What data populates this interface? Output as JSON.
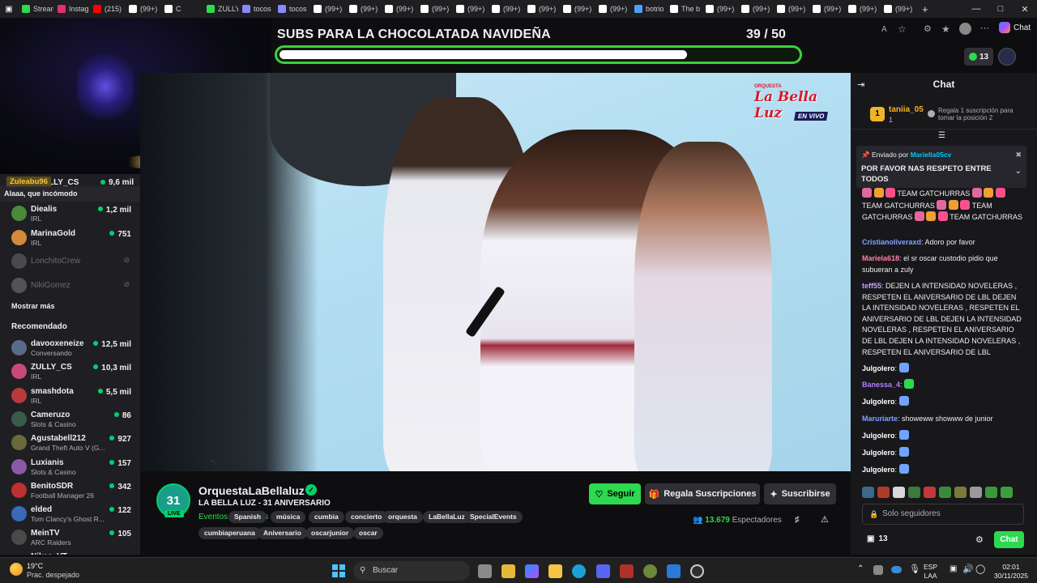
{
  "browser": {
    "tabs": [
      {
        "label": "",
        "color": "#ffffff"
      },
      {
        "label": "Stream",
        "color": "#2cd94f"
      },
      {
        "label": "Instag",
        "color": "#e1306c"
      },
      {
        "label": "(215)",
        "color": "#ff0000"
      },
      {
        "label": "(99+)",
        "color": "#ffffff"
      },
      {
        "label": "C",
        "color": "#ffffff"
      },
      {
        "label": "ZULLY",
        "color": "#2cd94f"
      },
      {
        "label": "tocos",
        "color": "#8888ff"
      },
      {
        "label": "tocos",
        "color": "#8888ff"
      },
      {
        "label": "(99+)",
        "color": "#ffffff"
      },
      {
        "label": "(99+)",
        "color": "#ffffff"
      },
      {
        "label": "(99+)",
        "color": "#ffffff"
      },
      {
        "label": "(99+)",
        "color": "#ffffff"
      },
      {
        "label": "(99+)",
        "color": "#ffffff"
      },
      {
        "label": "(99+)",
        "color": "#ffffff"
      },
      {
        "label": "(99+)",
        "color": "#ffffff"
      },
      {
        "label": "(99+)",
        "color": "#ffffff"
      },
      {
        "label": "(99+)",
        "color": "#ffffff"
      },
      {
        "label": "botrio",
        "color": "#4f9fff"
      },
      {
        "label": "The b",
        "color": "#ffffff"
      },
      {
        "label": "(99+)",
        "color": "#ffffff"
      },
      {
        "label": "(99+)",
        "color": "#ffffff"
      },
      {
        "label": "(99+)",
        "color": "#ffffff"
      },
      {
        "label": "(99+)",
        "color": "#ffffff"
      },
      {
        "label": "(99+)",
        "color": "#ffffff"
      },
      {
        "label": "(99+)",
        "color": "#ffffff"
      }
    ],
    "new_tab": "+"
  },
  "overlay": {
    "goal_title": "SUBS PARA LA CHOCOLATADA NAVIDEÑA",
    "goal_count": "39   / 50",
    "goal_progress": 0.78,
    "alert_user": "Zuleabu96",
    "alert_msg": "Alaaa, que incómodo"
  },
  "sidebar": {
    "followed": [
      {
        "name": "ZULLY_CS",
        "category": "",
        "viewers": "9,6 mil",
        "avatar": "#c94a7a",
        "online": true
      },
      {
        "name": "Diealis",
        "category": "IRL",
        "viewers": "1,2 mil",
        "avatar": "#4a8a3a",
        "online": true
      },
      {
        "name": "MarinaGold",
        "category": "IRL",
        "viewers": "751",
        "avatar": "#d48a3a",
        "online": true
      },
      {
        "name": "LonchitoCrew",
        "category": "",
        "viewers": "",
        "avatar": "#777777",
        "online": false
      },
      {
        "name": "NikiGomez",
        "category": "",
        "viewers": "",
        "avatar": "#888888",
        "online": false
      }
    ],
    "show_more": "Mostrar más",
    "recommended_title": "Recomendado",
    "recommended": [
      {
        "name": "davooxeneize",
        "category": "Conversando",
        "viewers": "12,5 mil",
        "avatar": "#5a6a8a"
      },
      {
        "name": "ZULLY_CS",
        "category": "IRL",
        "viewers": "10,3 mil",
        "avatar": "#c94a7a"
      },
      {
        "name": "smashdota",
        "category": "IRL",
        "viewers": "5,5 mil",
        "avatar": "#b83a3a"
      },
      {
        "name": "Cameruzo",
        "category": "Slots & Casino",
        "viewers": "86",
        "avatar": "#3a5a4a"
      },
      {
        "name": "Agustabell212",
        "category": "Grand Theft Auto V (G...",
        "viewers": "927",
        "avatar": "#6a6a3a"
      },
      {
        "name": "Luxianis",
        "category": "Slots & Casino",
        "viewers": "157",
        "avatar": "#8a5aa8"
      },
      {
        "name": "BenitoSDR",
        "category": "Football Manager 26",
        "viewers": "342",
        "avatar": "#c03030"
      },
      {
        "name": "elded",
        "category": "Tom Clancy's Ghost R...",
        "viewers": "122",
        "avatar": "#3a6ab8"
      },
      {
        "name": "MeinTV",
        "category": "ARC Raiders",
        "viewers": "105",
        "avatar": "#4a4a4a"
      }
    ],
    "partial_row": "Nikes_VT"
  },
  "video": {
    "logo_text": "La Bella Luz",
    "logo_sub": "EN VIVO",
    "logo_top": "ORQUESTA"
  },
  "channel": {
    "name": "OrquestaLaBellaluz",
    "avatar_text": "31",
    "live": "LIVE",
    "title": "LA BELLA LUZ -  31 ANIVERSARIO",
    "category": "Eventos especiales",
    "tags": [
      "Spanish",
      "música",
      "cumbia",
      "concierto",
      "orquesta",
      "LaBellaLuz",
      "SpecialEvents",
      "cumbiaperuana",
      "Aniversario",
      "oscarjunior",
      "oscar"
    ],
    "follow": "Seguir",
    "gift": "Regala Suscripciones",
    "subscribe": "Suscribirse",
    "viewer_count": "13.679",
    "viewer_label": "Espectadores"
  },
  "top_right": {
    "points": "13"
  },
  "chat": {
    "title": "Chat",
    "leader_name": "taniia_05",
    "leader_rank": "1",
    "leader_count": "1",
    "leader_hint": "Regala 1 suscripción para tomar la posición 2",
    "pinned_by_label": "Enviado por",
    "pinned_by_user": "Mariella05cv",
    "pinned_msg": "POR FAVOR NAS RESPETO ENTRE TODOS",
    "messages": [
      {
        "user": "",
        "color": "#efeff1",
        "text": "TEAM GATCHURRAS TEAM GATCHURRAS TEAM GATCHURRAS TEAM GATCHURRAS",
        "prefix": "emotes"
      },
      {
        "user": "Cristianoliveraxd",
        "color": "#7fa3ff",
        "text": "Adoro por favor"
      },
      {
        "user": "Mariela618",
        "color": "#ff7fa8",
        "text": "el sr oscar custodio pidio que subueran a zuly"
      },
      {
        "user": "teff55",
        "color": "#c9a0ff",
        "text": "DEJEN LA INTENSIDAD NOVELERAS , RESPETEN EL ANIVERSARIO DE LBL DEJEN LA INTENSIDAD NOVELERAS , RESPETEN EL ANIVERSARIO DE LBL DEJEN LA INTENSIDAD NOVELERAS , RESPETEN EL ANIVERSARIO DE LBL DEJEN LA INTENSIDAD NOVELERAS , RESPETEN EL ANIVERSARIO DE LBL"
      },
      {
        "user": "Julgolero",
        "color": "#ffffff",
        "text": "",
        "emote": "#6fa3ff"
      },
      {
        "user": "Banessa_4",
        "color": "#b07fff",
        "text": "",
        "emote": "#2cd94f"
      },
      {
        "user": "Julgolero",
        "color": "#ffffff",
        "text": "",
        "emote": "#6fa3ff"
      },
      {
        "user": "Maruriarte",
        "color": "#7fa3ff",
        "text": "showeww showww de junior"
      },
      {
        "user": "Julgolero",
        "color": "#ffffff",
        "text": "",
        "emote": "#6fa3ff"
      },
      {
        "user": "Julgolero",
        "color": "#ffffff",
        "text": "",
        "emote": "#6fa3ff"
      },
      {
        "user": "Julgolero",
        "color": "#ffffff",
        "text": "",
        "emote": "#6fa3ff"
      }
    ],
    "input_placeholder": "Solo seguidores",
    "points": "13",
    "send": "Chat"
  },
  "taskbar": {
    "weather_temp": "19°C",
    "weather_desc": "Prac. despejado",
    "search": "Buscar",
    "lang_top": "ESP",
    "lang_bottom": "LAA",
    "time": "02:01",
    "date": "30/11/2025"
  },
  "colors": {
    "accent": "#2cd94f",
    "goal_border": "#3ecf3e",
    "live_dot": "#00d26a"
  }
}
